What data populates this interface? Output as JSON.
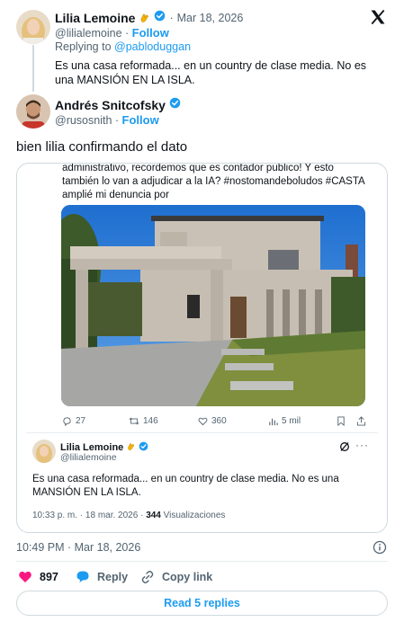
{
  "main_tweet": {
    "author": "Lilia Lemoine",
    "handle": "@lilialemoine",
    "date": "Mar 18, 2026",
    "follow_label": "Follow",
    "replying_prefix": "Replying to",
    "replying_to": "@pabloduggan",
    "text": "Es una casa reformada... en un country de clase media. No es una MANSIÓN EN LA ISLA.",
    "author_badge": "clapping-hands-emoji",
    "verified": true
  },
  "reply": {
    "author": "Andrés Snitcofsky",
    "handle": "@rusosnith",
    "follow_label": "Follow",
    "text": "bien lilia confirmando el dato",
    "verified": true
  },
  "embedded": {
    "quoted_text": "administrativo, recordemos que es contador publico! Y esto también lo van a adjudicar a la IA? #nostomandeboludos #CASTA amplié mi denuncia por",
    "stats": {
      "replies": "27",
      "retweets": "146",
      "likes": "360",
      "views": "5 mil"
    },
    "inner_tweet": {
      "author": "Lilia Lemoine",
      "handle": "@lilialemoine",
      "text": "Es una casa reformada... en un country de clase media. No es una MANSIÓN EN LA ISLA.",
      "timestamp": "10:33 p. m. · 18 mar. 2026 ·",
      "views_count": "344",
      "views_label": "Visualizaciones"
    }
  },
  "footer": {
    "timestamp": "10:49 PM · Mar 18, 2026",
    "likes": "897",
    "reply_label": "Reply",
    "copy_link_label": "Copy link",
    "read_replies_label": "Read 5 replies"
  },
  "colors": {
    "accent": "#1d9bf0",
    "like": "#f91880",
    "text": "#0f1419",
    "muted": "#536471"
  }
}
